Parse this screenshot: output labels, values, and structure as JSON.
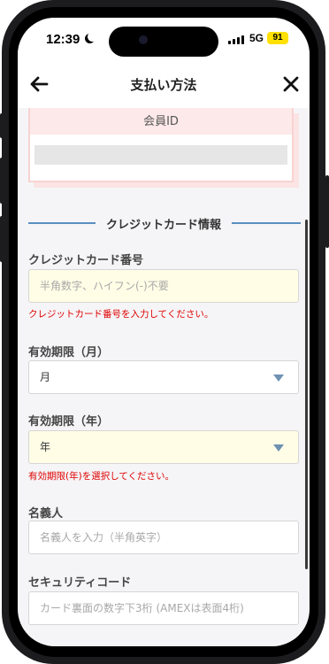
{
  "status_bar": {
    "time": "12:39",
    "network": "5G",
    "battery": "91",
    "battery_color": "#ffe000"
  },
  "header": {
    "title": "支払い方法",
    "back_icon": "arrow-left-icon",
    "close_icon": "close-icon"
  },
  "member": {
    "label": "会員ID",
    "value": ""
  },
  "section": {
    "title": "クレジットカード情報",
    "accent_color": "#5a8fc1"
  },
  "fields": {
    "card_number": {
      "label": "クレジットカード番号",
      "placeholder": "半角数字、ハイフン(-)不要",
      "error": "クレジットカード番号を入力してください。"
    },
    "expiry_month": {
      "label": "有効期限（月）",
      "value": "月"
    },
    "expiry_year": {
      "label": "有効期限（年）",
      "value": "年",
      "error": "有効期限(年)を選択してください。"
    },
    "cardholder": {
      "label": "名義人",
      "placeholder": "名義人を入力（半角英字）"
    },
    "security_code": {
      "label": "セキュリティコード",
      "placeholder": "カード裏面の数字下3桁 (AMEXは表面4桁)"
    }
  },
  "colors": {
    "error": "#e00000",
    "required_bg": "#fffde6"
  }
}
